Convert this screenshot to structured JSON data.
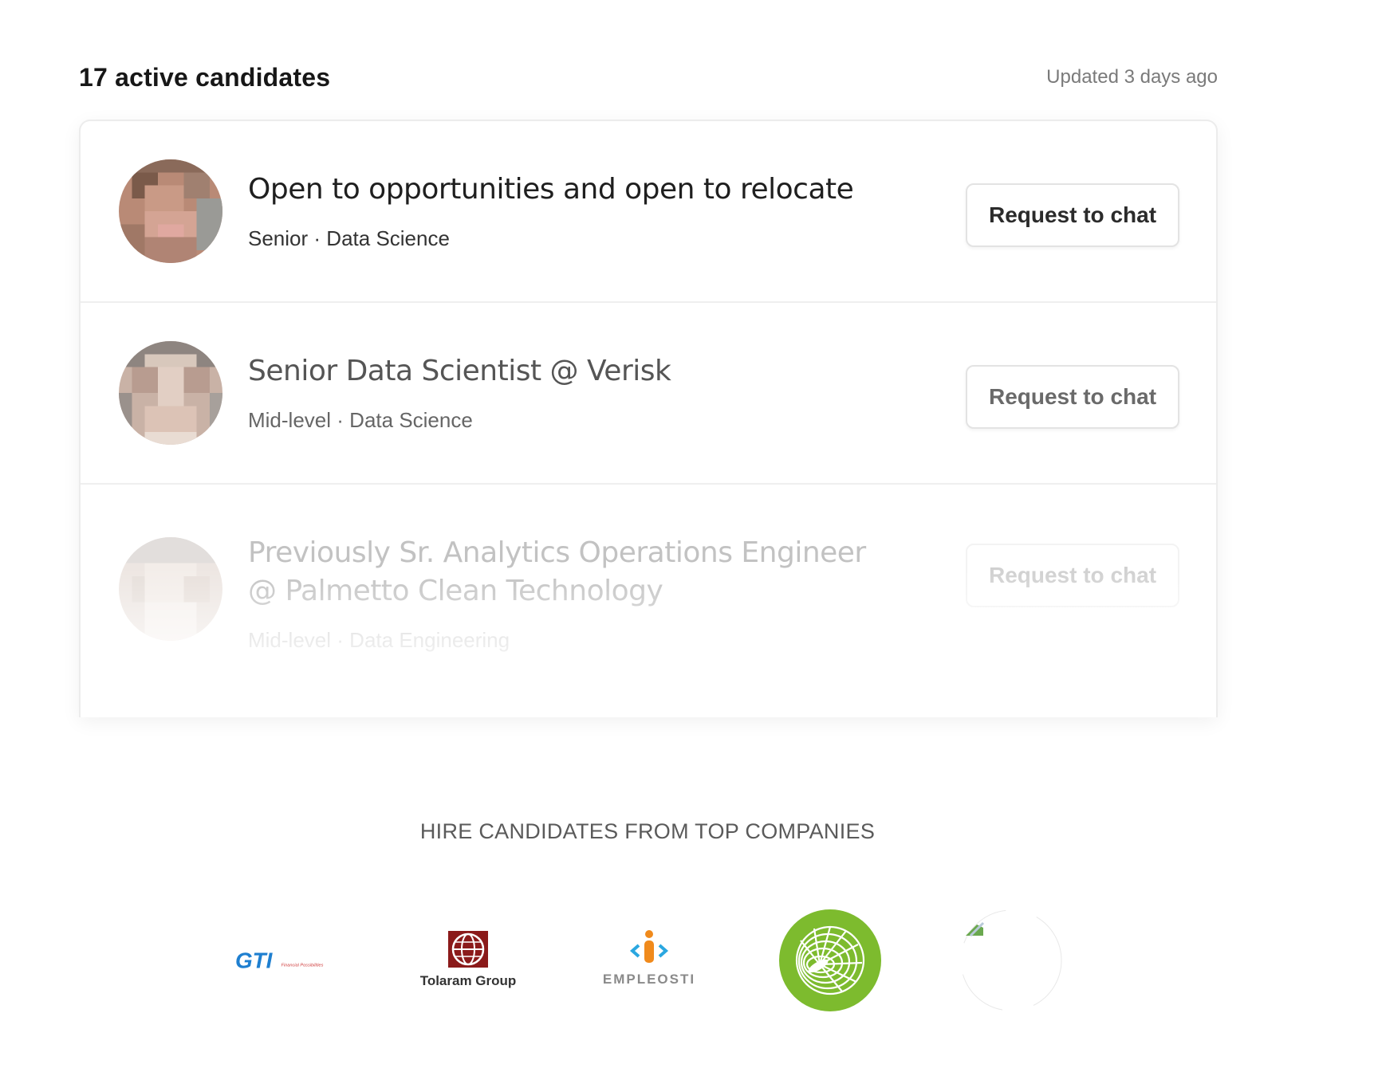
{
  "header": {
    "title": "17 active candidates",
    "updated": "Updated 3 days ago"
  },
  "candidates": [
    {
      "headline": "Open to opportunities and open to relocate",
      "level": "Senior",
      "separator": "·",
      "field": "Data Science",
      "action_label": "Request to chat"
    },
    {
      "headline": "Senior Data Scientist @ Verisk",
      "level": "Mid-level",
      "separator": "·",
      "field": "Data Science",
      "action_label": "Request to chat"
    },
    {
      "headline": "Previously Sr. Analytics Operations Engineer @ Palmetto Clean Technology",
      "level": "Mid-level",
      "separator": "·",
      "field": "Data Engineering",
      "action_label": "Request to chat"
    }
  ],
  "companies": {
    "title": "HIRE CANDIDATES FROM TOP COMPANIES",
    "logos": [
      {
        "name": "GTI",
        "tagline": "Financial Possibilities",
        "color": "#1e7fd0"
      },
      {
        "name": "Tolaram Group",
        "color": "#8b1a1a"
      },
      {
        "name": "EMPLEOSTI",
        "color": "#2aa7e0"
      },
      {
        "name": "green-swirl-logo",
        "color": "#7dbb2e"
      },
      {
        "name": "broken-image-logo"
      }
    ]
  },
  "colors": {
    "border": "#ececec",
    "text_primary": "#171717",
    "text_muted": "#7a7a7a"
  }
}
